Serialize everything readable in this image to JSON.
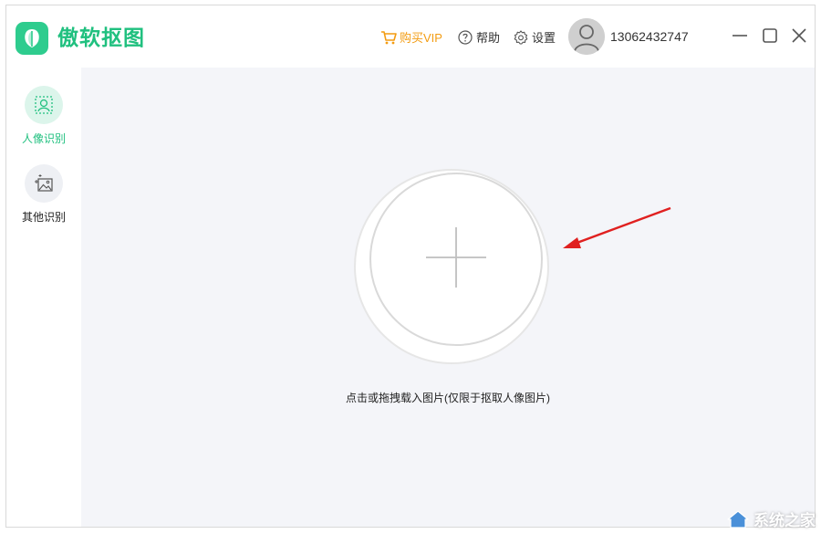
{
  "app": {
    "name": "傲软抠图"
  },
  "header": {
    "vip_label": "购买VIP",
    "help_label": "帮助",
    "settings_label": "设置",
    "user_phone": "13062432747"
  },
  "sidebar": {
    "items": [
      {
        "label": "人像识别",
        "icon": "portrait-scan-icon",
        "active": true
      },
      {
        "label": "其他识别",
        "icon": "image-sparkle-icon",
        "active": false
      }
    ]
  },
  "main": {
    "upload_hint": "点击或拖拽载入图片(仅限于抠取人像图片)"
  },
  "watermark": {
    "text": "系统之家"
  },
  "colors": {
    "brand": "#20c07f",
    "vip": "#f39c12",
    "annotation_arrow": "#e02020",
    "canvas_bg": "#f4f5f9"
  }
}
